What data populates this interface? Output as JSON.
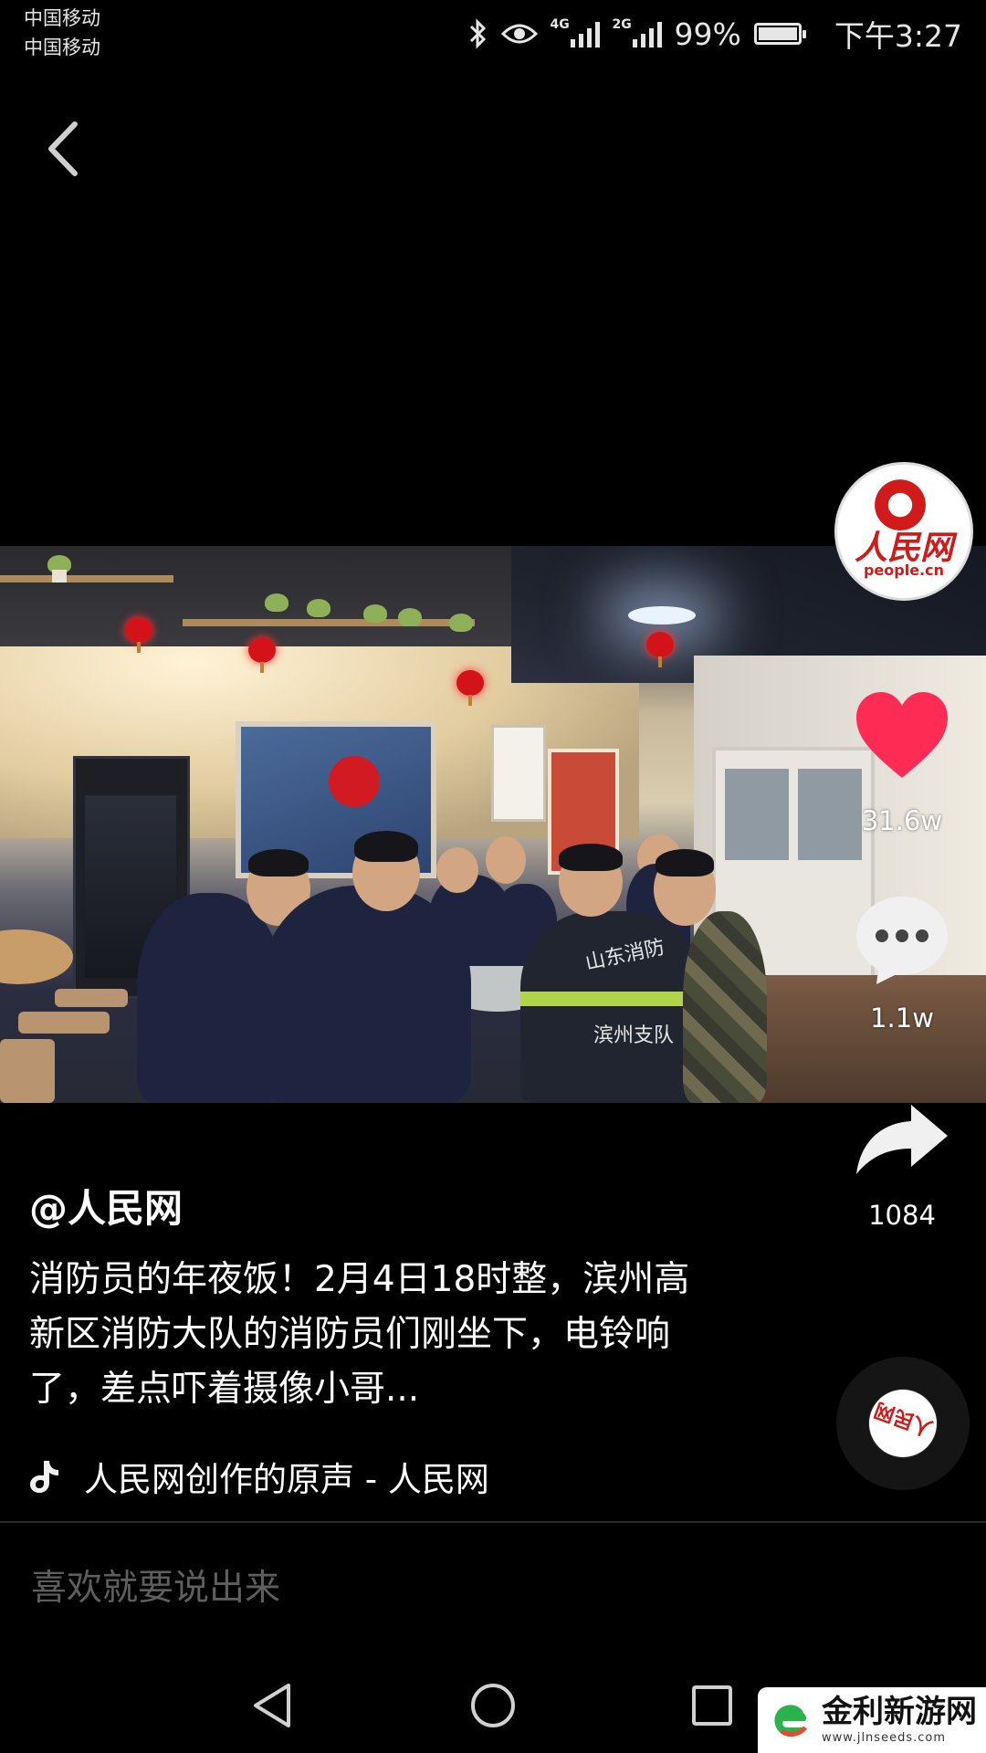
{
  "status_bar": {
    "carrier_1": "中国移动",
    "carrier_2": "中国移动",
    "network_1": "4G",
    "network_2": "2G",
    "battery": "99%",
    "battery_level": 0.99,
    "time": "下午3:27",
    "icons": [
      "bluetooth-icon",
      "eye-icon",
      "signal-icon",
      "signal-icon",
      "battery-icon"
    ]
  },
  "video": {
    "channel_logo_cn": "人民网",
    "channel_logo_en": "people.cn",
    "jacket_text_1": "山东消防",
    "jacket_text_2": "滨州支队"
  },
  "actions": {
    "likes": "31.6w",
    "comments": "1.1w",
    "shares": "1084",
    "like_color": "#fe2c55"
  },
  "post": {
    "username": "@人民网",
    "caption": "消防员的年夜饭！2月4日18时整，滨州高新区消防大队的消防员们刚坐下，电铃响了，差点吓着摄像小哥...",
    "music": "人民网创作的原声 - 人民网"
  },
  "comment_box": {
    "placeholder": "喜欢就要说出来"
  },
  "watermark": {
    "title": "金利新游网",
    "url": "www.jlnseeds.com"
  }
}
